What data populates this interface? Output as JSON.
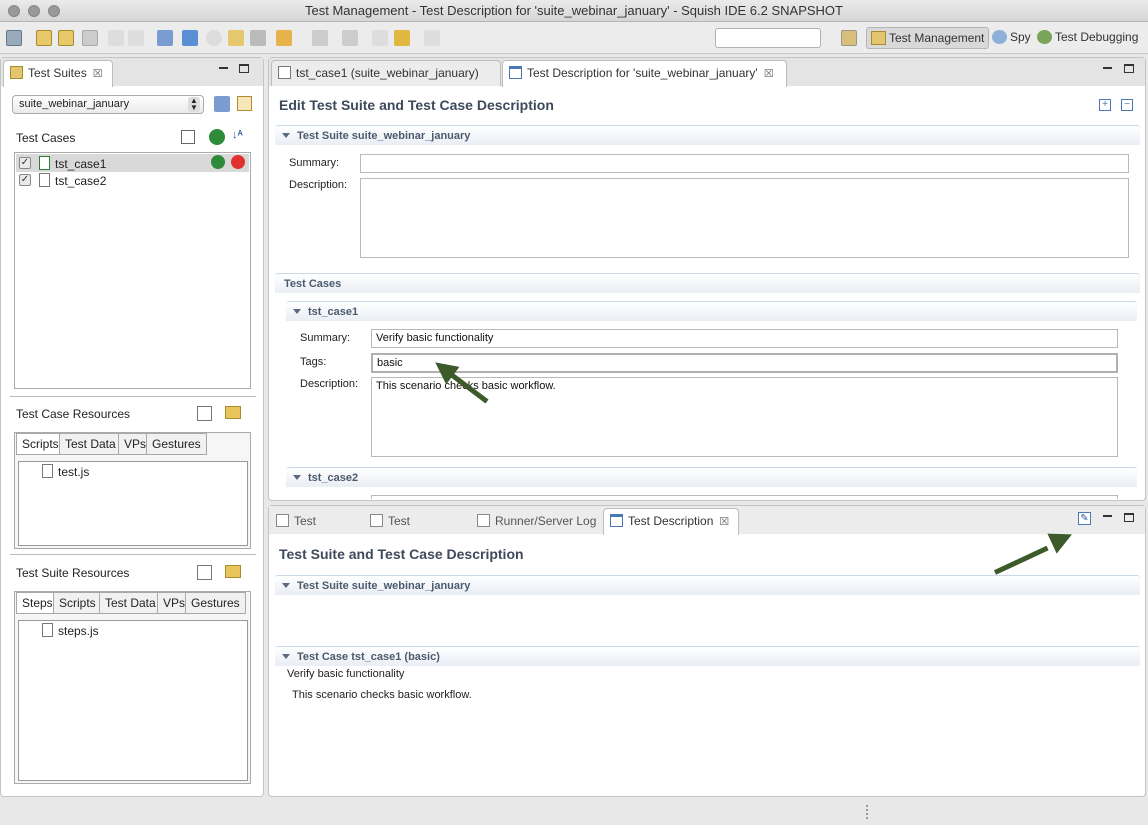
{
  "window": {
    "title": "Test Management - Test Description for 'suite_webinar_january' - Squish IDE 6.2 SNAPSHOT"
  },
  "perspectives": [
    {
      "label": "Test Management",
      "active": true
    },
    {
      "label": "Spy",
      "active": false
    },
    {
      "label": "Test Debugging",
      "active": false
    }
  ],
  "left": {
    "suites_tab": "Test Suites",
    "suite_select": "suite_webinar_january",
    "test_cases_label": "Test Cases",
    "test_cases": [
      "tst_case1",
      "tst_case2"
    ],
    "tc_resources_label": "Test Case Resources",
    "tc_tabs": [
      "Scripts",
      "Test Data",
      "VPs",
      "Gestures"
    ],
    "tc_files": [
      "test.js"
    ],
    "ts_resources_label": "Test Suite Resources",
    "ts_tabs": [
      "Steps",
      "Scripts",
      "Test Data",
      "VPs",
      "Gestures"
    ],
    "ts_files": [
      "steps.js"
    ]
  },
  "editor": {
    "tabs": [
      "tst_case1 (suite_webinar_january)",
      "Test Description for 'suite_webinar_january'"
    ],
    "heading": "Edit Test Suite and Test Case Description",
    "suite_section": "Test Suite suite_webinar_january",
    "summary_label": "Summary:",
    "description_label": "Description:",
    "tags_label": "Tags:",
    "test_cases_section": "Test Cases",
    "case1_section": "tst_case1",
    "case1_summary": "Verify basic functionality",
    "case1_tags": "basic",
    "case1_description": "This scenario checks basic workflow.",
    "case2_section": "tst_case2"
  },
  "bottom": {
    "tabs": [
      "Test Results",
      "Test Summary",
      "Runner/Server Log",
      "Test Description"
    ],
    "heading": "Test Suite and Test Case Description",
    "suite_section": "Test Suite suite_webinar_january",
    "case_section": "Test Case tst_case1 (basic)",
    "case_summary": "Verify basic functionality",
    "case_description": "This scenario checks basic workflow."
  },
  "colors": {
    "arrow": "#3d5a2a",
    "section_text": "#4c5a6e",
    "heading_text": "#3e4a5c"
  }
}
